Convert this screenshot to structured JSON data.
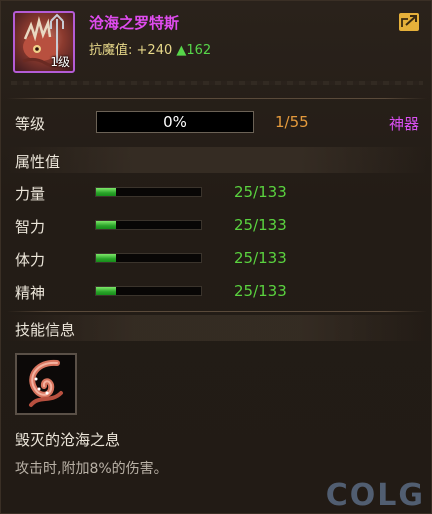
{
  "item": {
    "name": "沧海之罗特斯",
    "level_badge": "1级",
    "resist_label": "抗魔值:",
    "resist_base": "+240",
    "resist_bonus": "▲162",
    "border_color": "#b45cd6"
  },
  "level": {
    "label": "等级",
    "progress_text": "0%",
    "progress": 0,
    "count": "1/55",
    "grade": "神器"
  },
  "attributes": {
    "title": "属性值",
    "stats": [
      {
        "label": "力量",
        "value": "25/133",
        "fraction": 0.188
      },
      {
        "label": "智力",
        "value": "25/133",
        "fraction": 0.188
      },
      {
        "label": "体力",
        "value": "25/133",
        "fraction": 0.188
      },
      {
        "label": "精神",
        "value": "25/133",
        "fraction": 0.188
      }
    ]
  },
  "skill": {
    "section_title": "技能信息",
    "icon": "tentacle-icon",
    "name": "毁灭的沧海之息",
    "description": "攻击时,附加8%的伤害。"
  },
  "watermark": "COLG",
  "colors": {
    "name": "#e04cf0",
    "grade": "#d84ff0",
    "stat_value": "#5ad23f",
    "level_count": "#e49a3c",
    "accent_share": "#e5b03a"
  }
}
